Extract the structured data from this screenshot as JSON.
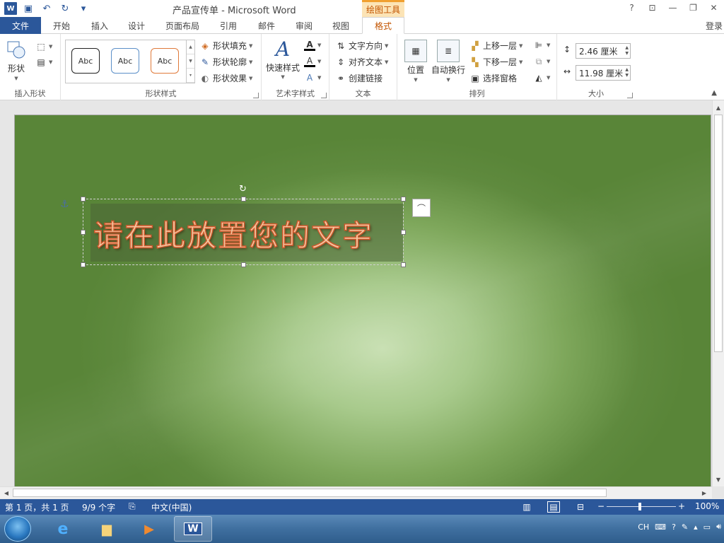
{
  "titlebar": {
    "title": "产品宣传单 - Microsoft Word",
    "context_tab_header": "绘图工具",
    "help": "?",
    "ribbon_display": "⊡",
    "minimize": "—",
    "restore": "❐",
    "close": "✕"
  },
  "quick_access": {
    "word_icon": "W",
    "save_icon": "💾",
    "undo_icon": "↶",
    "redo_icon": "↻",
    "customize_icon": "▾"
  },
  "tabs": {
    "file": "文件",
    "home": "开始",
    "insert": "插入",
    "design": "设计",
    "layout": "页面布局",
    "references": "引用",
    "mailings": "邮件",
    "review": "审阅",
    "view": "视图",
    "format": "格式",
    "login": "登录"
  },
  "ribbon": {
    "insert_shapes": {
      "label": "插入形状",
      "shapes": "形状"
    },
    "shape_styles": {
      "label": "形状样式",
      "abc": "Abc",
      "fill": "形状填充",
      "outline": "形状轮廓",
      "effects": "形状效果"
    },
    "wordart_styles": {
      "label": "艺术字样式",
      "quick_styles": "快速样式"
    },
    "text": {
      "label": "文本",
      "direction": "文字方向",
      "align": "对齐文本",
      "link": "创建链接"
    },
    "arrange": {
      "label": "排列",
      "position": "位置",
      "wrap": "自动换行",
      "bring_forward": "上移一层",
      "send_backward": "下移一层",
      "selection_pane": "选择窗格"
    },
    "size": {
      "label": "大小",
      "height": "2.46 厘米",
      "width": "11.98 厘米"
    }
  },
  "document": {
    "wordart_text": "请在此放置您的文字"
  },
  "statusbar": {
    "page": "第 1 页，共 1 页",
    "words": "9/9 个字",
    "language": "中文(中国)",
    "zoom_minus": "−",
    "zoom_plus": "+",
    "zoom": "100%"
  },
  "taskbar": {
    "tray_lang": "CH"
  }
}
